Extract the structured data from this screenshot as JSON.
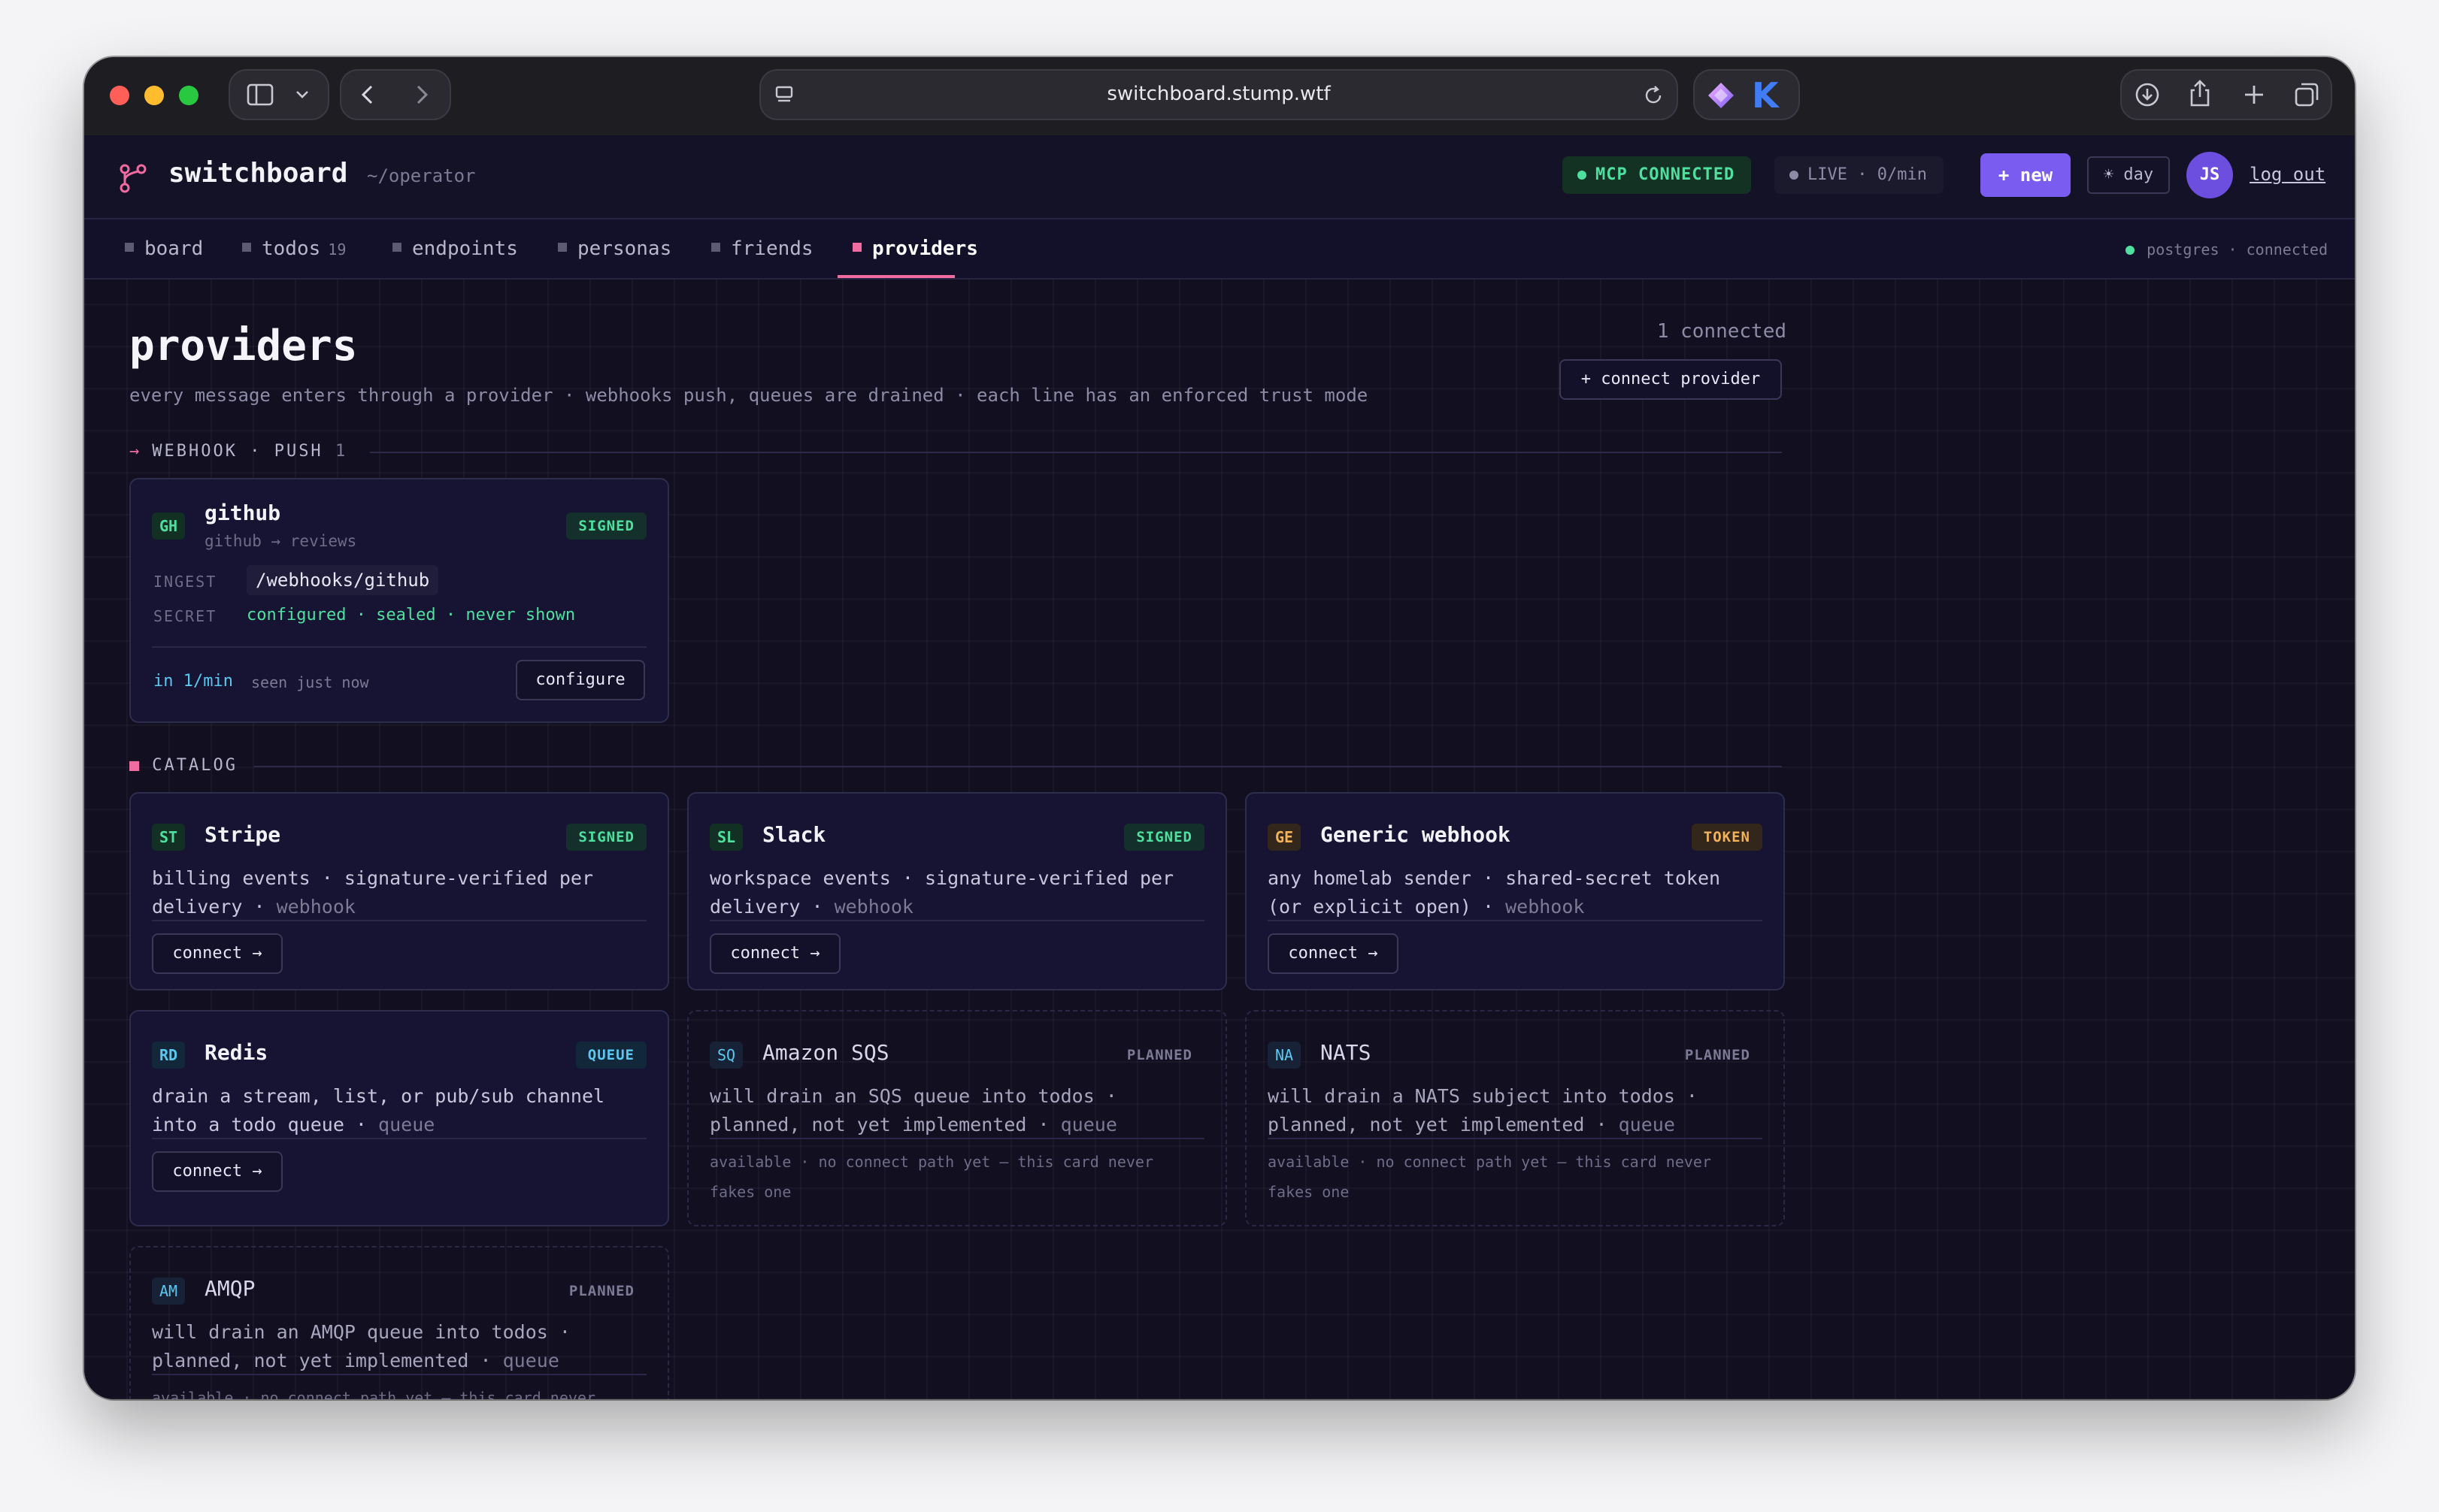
{
  "browser": {
    "url": "switchboard.stump.wtf"
  },
  "app": {
    "name": "switchboard",
    "path": "~/operator",
    "mcp_badge": "MCP CONNECTED",
    "live_badge": "LIVE · 0/min",
    "new_button": "+ new",
    "theme_button": "☀ day",
    "avatar_initials": "JS",
    "logout_label": "log out"
  },
  "tabs": [
    {
      "label": "board",
      "count": ""
    },
    {
      "label": "todos",
      "count": "19"
    },
    {
      "label": "endpoints",
      "count": ""
    },
    {
      "label": "personas",
      "count": ""
    },
    {
      "label": "friends",
      "count": ""
    },
    {
      "label": "providers",
      "count": ""
    }
  ],
  "active_tab": "providers",
  "db_status": "postgres · connected",
  "page": {
    "title": "providers",
    "subtitle": "every message enters through a provider · webhooks push, queues are drained · each line has an enforced trust mode",
    "connected_count": "1 connected",
    "connect_provider_button": "+ connect provider"
  },
  "webhook_section": {
    "label": "WEBHOOK · PUSH",
    "count": "1",
    "card": {
      "abbr": "GH",
      "name": "github",
      "route": "github → reviews",
      "tag": "SIGNED",
      "ingest_label": "INGEST",
      "ingest_value": "/webhooks/github",
      "secret_label": "SECRET",
      "secret_value": "configured · sealed · never shown",
      "rate": "in 1/min",
      "seen": "seen just now",
      "configure_button": "configure"
    }
  },
  "catalog_section": {
    "label": "CATALOG",
    "cards": [
      {
        "abbr": "ST",
        "name": "Stripe",
        "tag": "SIGNED",
        "desc": "billing events · signature-verified per delivery ·",
        "kind": "webhook",
        "button": "connect →"
      },
      {
        "abbr": "SL",
        "name": "Slack",
        "tag": "SIGNED",
        "desc": "workspace events · signature-verified per delivery ·",
        "kind": "webhook",
        "button": "connect →"
      },
      {
        "abbr": "GE",
        "name": "Generic webhook",
        "tag": "TOKEN",
        "desc": "any homelab sender · shared-secret token (or explicit open) ·",
        "kind": "webhook",
        "button": "connect →"
      },
      {
        "abbr": "RD",
        "name": "Redis",
        "tag": "QUEUE",
        "desc": "drain a stream, list, or pub/sub channel into a todo queue ·",
        "kind": "queue",
        "button": "connect →"
      },
      {
        "abbr": "SQ",
        "name": "Amazon SQS",
        "tag": "PLANNED",
        "desc": "will drain an SQS queue into todos · planned, not yet implemented ·",
        "kind": "queue",
        "footer": "available · no connect path yet — this card never fakes one"
      },
      {
        "abbr": "NA",
        "name": "NATS",
        "tag": "PLANNED",
        "desc": "will drain a NATS subject into todos · planned, not yet implemented ·",
        "kind": "queue",
        "footer": "available · no connect path yet — this card never fakes one"
      },
      {
        "abbr": "AM",
        "name": "AMQP",
        "tag": "PLANNED",
        "desc": "will drain an AMQP queue into todos · planned, not yet implemented ·",
        "kind": "queue",
        "footer": "available · no connect path yet — this card never fakes one"
      }
    ]
  },
  "colors": {
    "accent": "#7b5cf0",
    "active_tab": "#f06ba0",
    "signed": "#4fe0a0",
    "token": "#f2b25a",
    "queue": "#5ac8f0"
  }
}
